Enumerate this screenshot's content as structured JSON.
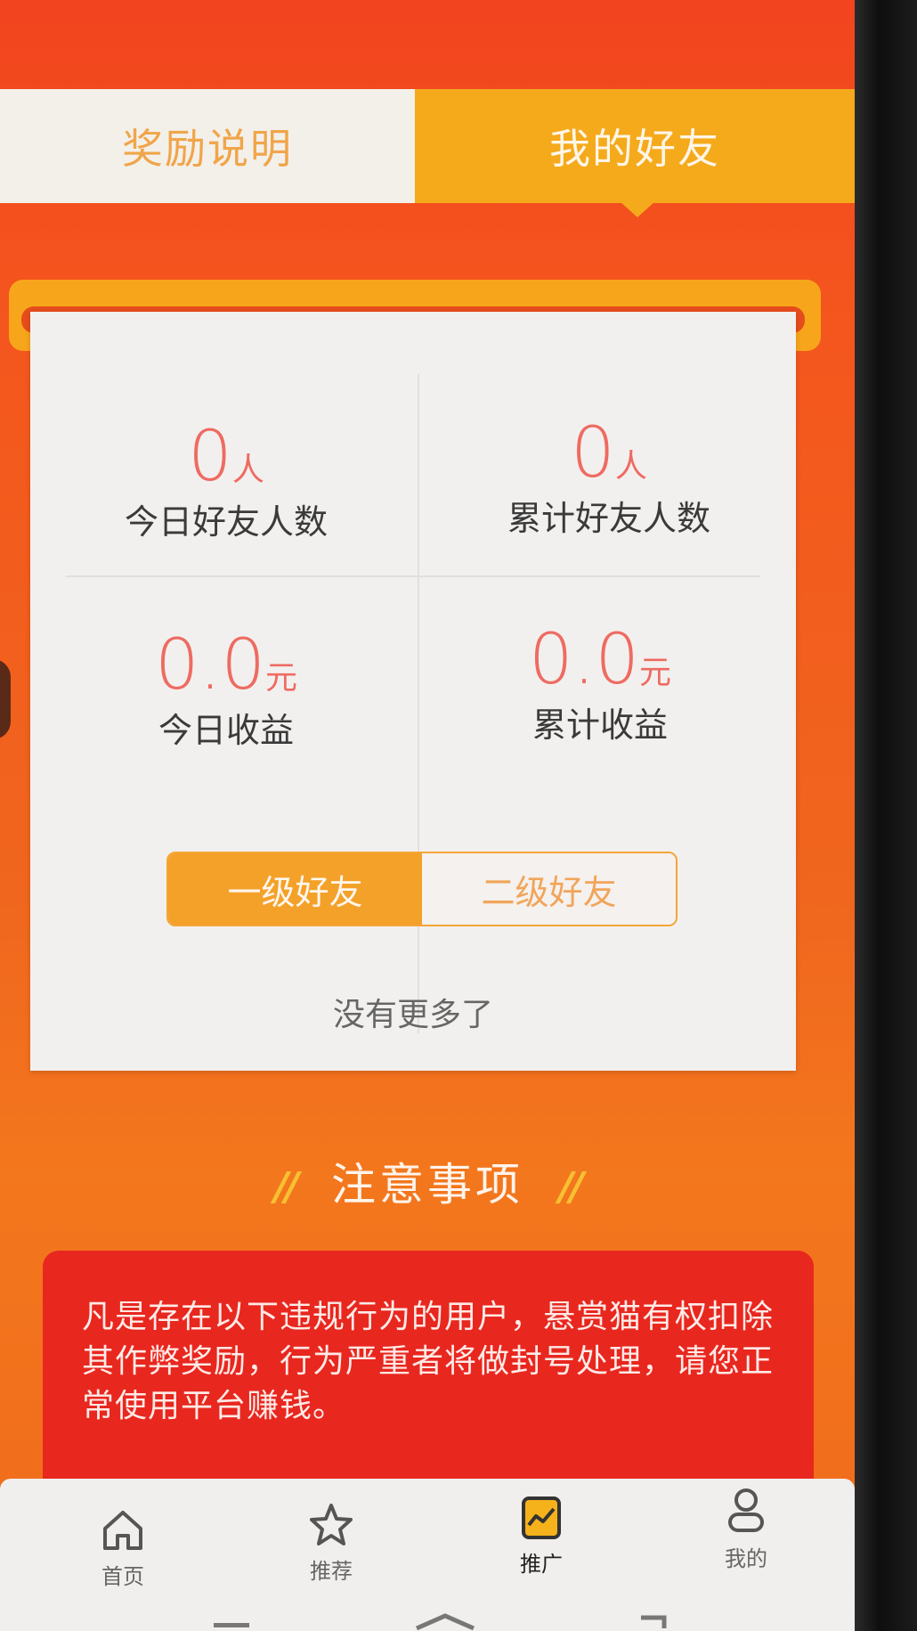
{
  "tabs": {
    "reward_info": "奖励说明",
    "my_friends": "我的好友"
  },
  "stats": {
    "today_friends": {
      "value": "0",
      "unit": "人",
      "label": "今日好友人数"
    },
    "total_friends": {
      "value": "0",
      "unit": "人",
      "label": "累计好友人数"
    },
    "today_income": {
      "value": "0.0",
      "unit": "元",
      "label": "今日收益"
    },
    "total_income": {
      "value": "0.0",
      "unit": "元",
      "label": "累计收益"
    }
  },
  "friend_levels": {
    "level1": "一级好友",
    "level2": "二级好友",
    "selected": "一级好友"
  },
  "empty_text": "没有更多了",
  "notice": {
    "title": "注意事项",
    "slashes": "//",
    "body": "凡是存在以下违规行为的用户，悬赏猫有权扣除其作弊奖励，行为严重者将做封号处理，请您正常使用平台赚钱。"
  },
  "bottom_nav": {
    "home": "首页",
    "recommend": "推荐",
    "promote": "推广",
    "mine": "我的",
    "active": "推广"
  },
  "colors": {
    "accent_orange": "#f5aa1c",
    "value_red": "#ee6b62",
    "notice_red": "#e8271f"
  }
}
